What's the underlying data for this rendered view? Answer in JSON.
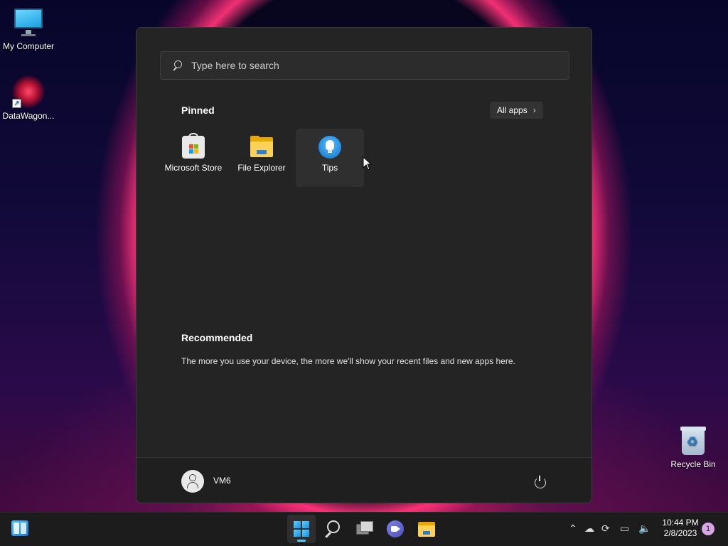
{
  "desktop": {
    "icons": [
      {
        "label": "My Computer",
        "icon": "monitor-icon"
      },
      {
        "label": "DataWagon...",
        "icon": "datawagon-icon"
      },
      {
        "label": "Recycle Bin",
        "icon": "recycle-bin-icon"
      }
    ]
  },
  "start_menu": {
    "search_placeholder": "Type here to search",
    "pinned_title": "Pinned",
    "all_apps_label": "All apps",
    "pinned_apps": [
      {
        "label": "Microsoft Store",
        "icon": "store-icon"
      },
      {
        "label": "File Explorer",
        "icon": "folder-icon"
      },
      {
        "label": "Tips",
        "icon": "tips-icon"
      }
    ],
    "recommended_title": "Recommended",
    "recommended_text": "The more you use your device, the more we'll show your recent files and new apps here.",
    "user_name": "VM6"
  },
  "taskbar": {
    "clock_time": "10:44 PM",
    "clock_date": "2/8/2023",
    "notification_count": "1",
    "accent_color": "#5cc8ff"
  }
}
